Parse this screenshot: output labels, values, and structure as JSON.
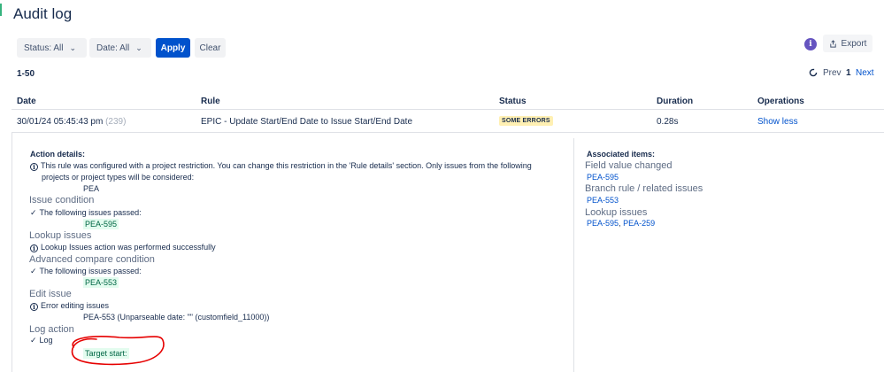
{
  "page": {
    "title": "Audit log"
  },
  "filters": {
    "status_label": "Status: All",
    "date_label": "Date: All",
    "apply": "Apply",
    "clear": "Clear"
  },
  "toolbar": {
    "info_icon": "i",
    "export": "Export"
  },
  "pagination": {
    "range": "1-50",
    "prev": "Prev",
    "current": "1",
    "next": "Next"
  },
  "table": {
    "headers": [
      "Date",
      "Rule",
      "Status",
      "Duration",
      "Operations"
    ],
    "row": {
      "date": "30/01/24 05:45:43 pm",
      "count": "(239)",
      "rule": "EPIC - Update Start/End Date to Issue Start/End Date",
      "status": "SOME ERRORS",
      "duration": "0.28s",
      "operation": "Show less"
    }
  },
  "details": {
    "title": "Action details:",
    "restriction_line1": "This rule was configured with a project restriction. You can change this restriction in the 'Rule details' section. Only issues from the following",
    "restriction_line2": "projects or project types will be considered:",
    "project": "PEA",
    "issue_condition": {
      "heading": "Issue condition",
      "text": "The following issues passed:",
      "issue": "PEA-595"
    },
    "lookup": {
      "heading": "Lookup issues",
      "text": "Lookup Issues action was performed successfully"
    },
    "advanced": {
      "heading": "Advanced compare condition",
      "text": "The following issues passed:",
      "issue": "PEA-553"
    },
    "edit": {
      "heading": "Edit issue",
      "text": "Error editing issues",
      "error": "PEA-553 (Unparseable date: \"\" (customfield_11000))"
    },
    "log": {
      "heading": "Log action",
      "text": "Log",
      "value": "Target start:"
    }
  },
  "associated": {
    "title": "Associated items:",
    "field_changed": {
      "heading": "Field value changed",
      "link": "PEA-595"
    },
    "branch": {
      "heading": "Branch rule / related issues",
      "link": "PEA-553"
    },
    "lookup": {
      "heading": "Lookup issues",
      "link1": "PEA-595",
      "separator": ",",
      "link2": "PEA-259"
    }
  },
  "colors": {
    "accent": "#0052cc",
    "annotation": "#e60000",
    "badge": "#fff0b3"
  }
}
